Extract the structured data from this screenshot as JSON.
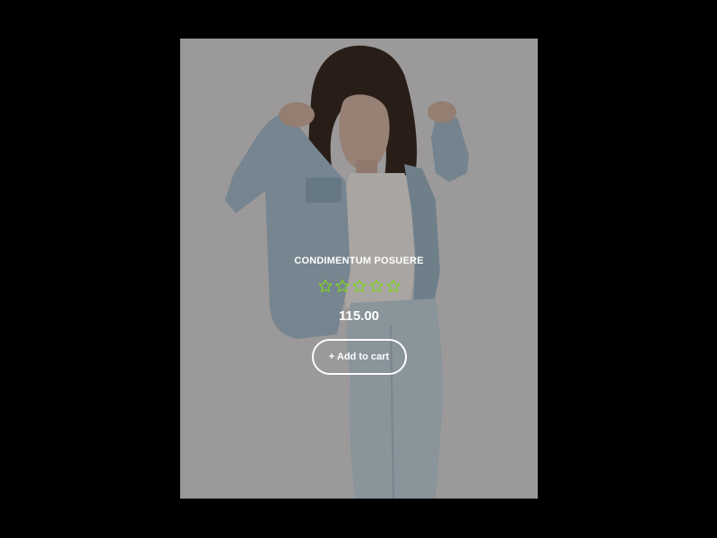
{
  "product": {
    "title": "CONDIMENTUM POSUERE",
    "price": "115.00",
    "rating": {
      "value": 0,
      "max": 5,
      "star_icon": "star-outline-icon",
      "star_color": "#7fd321"
    },
    "add_to_cart_label": "+ Add to cart",
    "image_icon": "product-photo"
  },
  "colors": {
    "background": "#000000",
    "text": "#ffffff",
    "accent": "#7fd321"
  }
}
